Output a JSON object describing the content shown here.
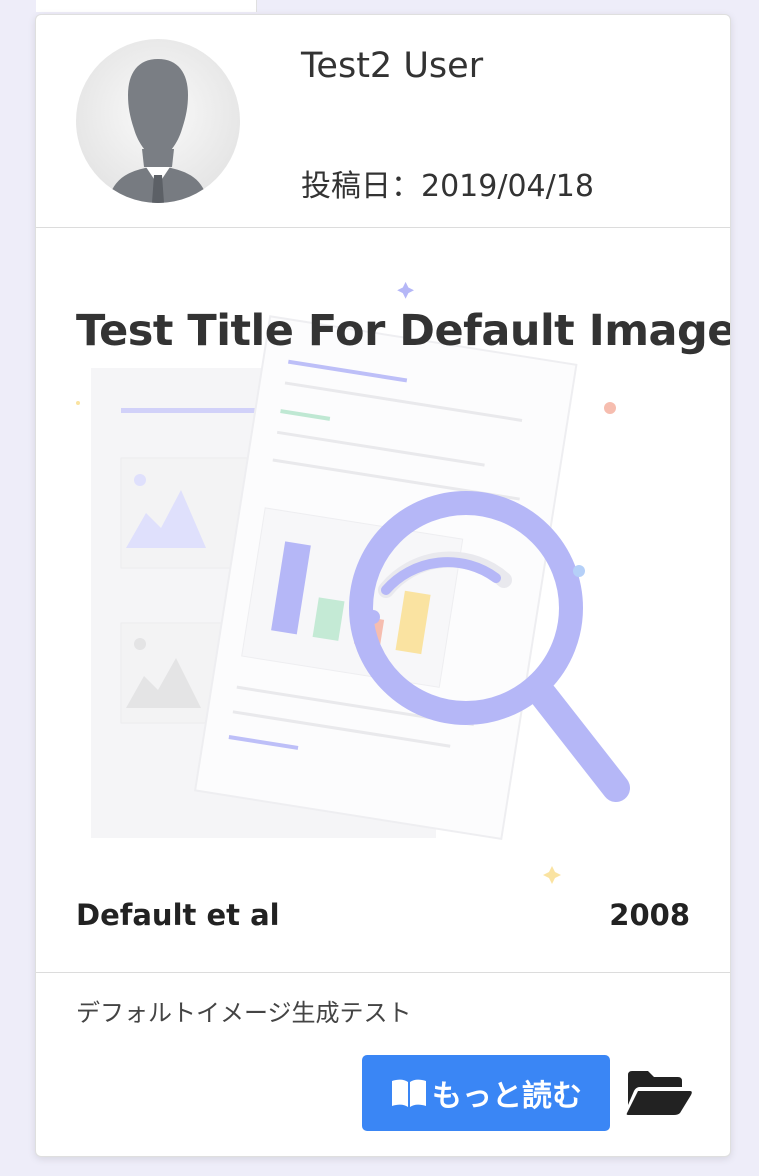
{
  "user": {
    "name": "Test2 User",
    "post_date": "投稿日：2019/04/18"
  },
  "paper": {
    "title": "Test Title For Default Images",
    "author": "Default et al",
    "year": "2008",
    "description": "デフォルトイメージ生成テスト"
  },
  "actions": {
    "read_more_label": "もっと読む",
    "read_more_icon": "open-book-icon",
    "folder_icon": "folder-open-icon"
  },
  "colors": {
    "page_background": "#eeedf9",
    "primary_button": "#3a86f5",
    "illustration_accent": "#8e92f3"
  }
}
